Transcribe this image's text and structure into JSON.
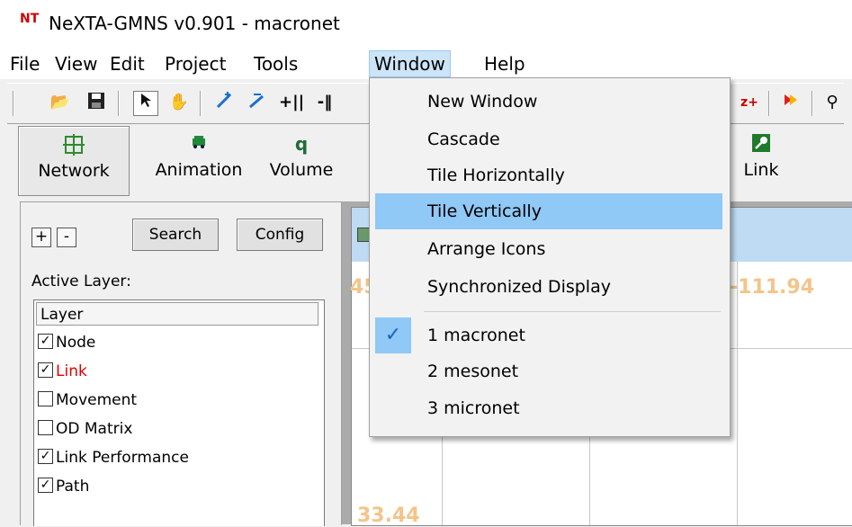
{
  "window": {
    "icon": "NT",
    "title": "NeXTA-GMNS v0.901 - macronet"
  },
  "menubar": [
    "File",
    "View",
    "Edit",
    "Project",
    "Tools",
    "Window",
    "Help"
  ],
  "toolbar": {
    "icons": [
      "open-folder-icon",
      "save-icon",
      "select-arrow-icon",
      "hand-pan-icon",
      "add-node-icon",
      "add-link-icon",
      "split-icon",
      "split-icon-2",
      "zoom-icon",
      "movement-icon",
      "search-icon"
    ]
  },
  "modes": [
    {
      "label": "Network",
      "icon": "network-grid-icon",
      "color": "#2e8b2e",
      "glyph": "⊞"
    },
    {
      "label": "Animation",
      "icon": "car-icon",
      "color": "#1f8a3a",
      "glyph": "⛟"
    },
    {
      "label": "Volume",
      "icon": "volume-icon",
      "color": "#1f6b3a",
      "glyph": "q"
    },
    {
      "label": "Link",
      "icon": "link-key-icon",
      "color": "#1f7a2a",
      "glyph": "⚿"
    }
  ],
  "leftpanel": {
    "plus": "+",
    "minus": "-",
    "search": "Search",
    "config": "Config",
    "active_layer": "Active Layer:",
    "layer_header": "Layer",
    "layers": [
      {
        "name": "Node",
        "checked": true,
        "color": "#000000"
      },
      {
        "name": "Link",
        "checked": true,
        "color": "#e00000"
      },
      {
        "name": "Movement",
        "checked": false,
        "color": "#000000"
      },
      {
        "name": "OD Matrix",
        "checked": false,
        "color": "#000000"
      },
      {
        "name": "Link Performance",
        "checked": true,
        "color": "#000000"
      },
      {
        "name": "Path",
        "checked": true,
        "color": "#000000"
      }
    ]
  },
  "canvas": {
    "coord_right": "-111.94",
    "coord_left_partial": "45",
    "coord_bottom_partial": "33.44"
  },
  "window_menu": {
    "items": [
      {
        "label": "New Window"
      },
      {
        "label": "Cascade"
      },
      {
        "label": "Tile Horizontally"
      },
      {
        "label": "Tile Vertically"
      },
      {
        "label": "Arrange Icons"
      },
      {
        "label": "Synchronized Display"
      },
      {
        "label": "1 macronet"
      },
      {
        "label": "2 mesonet"
      },
      {
        "label": "3 micronet"
      }
    ],
    "highlighted": "Tile Vertically",
    "checked": "1 macronet"
  },
  "colors": {
    "menu_highlight": "#90c8f6",
    "active_menu": "#cce4f7"
  }
}
